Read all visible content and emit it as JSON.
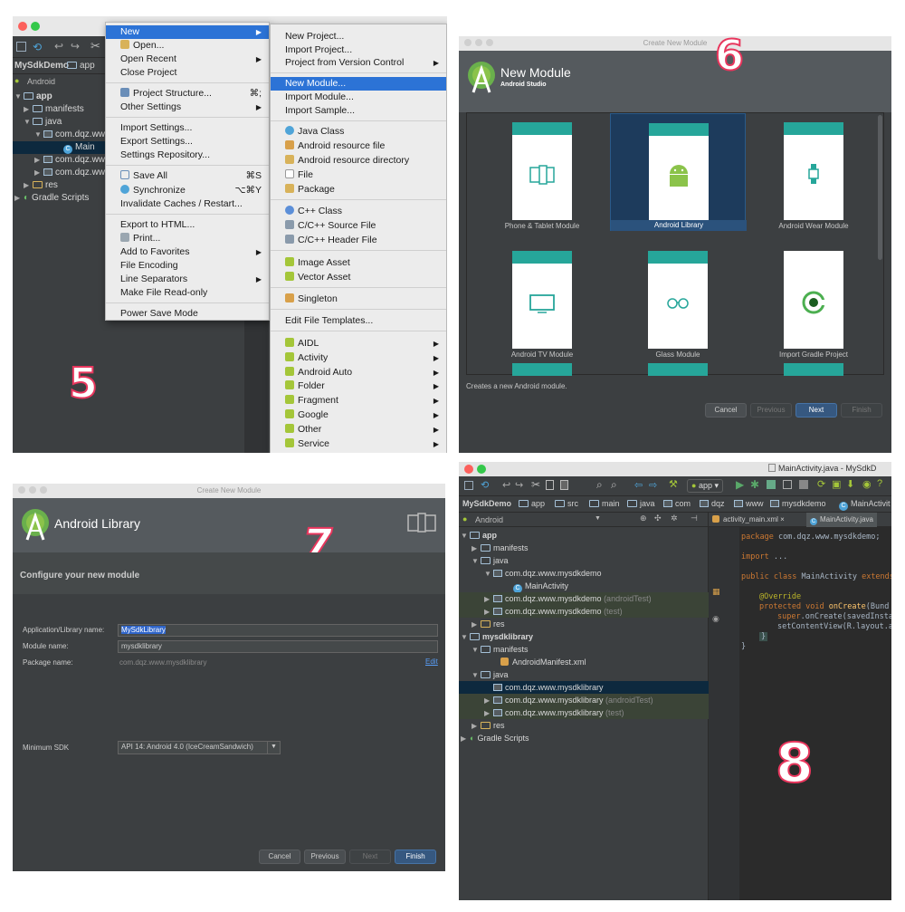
{
  "panel5": {
    "step": "5",
    "project": "MySdkDemo",
    "module": "app",
    "view": "Android",
    "tree": [
      "app",
      "manifests",
      "java",
      "com.dqz.ww",
      "Main",
      "com.dqz.ww",
      "com.dqz.ww",
      "res",
      "Gradle Scripts"
    ],
    "file_menu": {
      "items": [
        {
          "label": "New",
          "sub": "▶",
          "selected": true
        },
        {
          "label": "Open..."
        },
        {
          "label": "Open Recent",
          "sub": "▶"
        },
        {
          "label": "Close Project"
        },
        {
          "label": "Project Structure...",
          "shortcut": "⌘;"
        },
        {
          "label": "Other Settings",
          "sub": "▶"
        },
        {
          "label": "Import Settings..."
        },
        {
          "label": "Export Settings..."
        },
        {
          "label": "Settings Repository..."
        },
        {
          "label": "Save All",
          "shortcut": "⌘S"
        },
        {
          "label": "Synchronize",
          "shortcut": "⌥⌘Y"
        },
        {
          "label": "Invalidate Caches / Restart..."
        },
        {
          "label": "Export to HTML..."
        },
        {
          "label": "Print..."
        },
        {
          "label": "Add to Favorites",
          "sub": "▶"
        },
        {
          "label": "File Encoding"
        },
        {
          "label": "Line Separators",
          "sub": "▶"
        },
        {
          "label": "Make File Read-only"
        },
        {
          "label": "Power Save Mode"
        }
      ]
    },
    "new_menu": {
      "items": [
        {
          "label": "New Project..."
        },
        {
          "label": "Import Project..."
        },
        {
          "label": "Project from Version Control",
          "sub": "▶"
        },
        {
          "label": "New Module...",
          "selected": true
        },
        {
          "label": "Import Module..."
        },
        {
          "label": "Import Sample..."
        },
        {
          "label": "Java Class"
        },
        {
          "label": "Android resource file"
        },
        {
          "label": "Android resource directory"
        },
        {
          "label": "File"
        },
        {
          "label": "Package"
        },
        {
          "label": "C++ Class"
        },
        {
          "label": "C/C++ Source File"
        },
        {
          "label": "C/C++ Header File"
        },
        {
          "label": "Image Asset"
        },
        {
          "label": "Vector Asset"
        },
        {
          "label": "Singleton"
        },
        {
          "label": "Edit File Templates..."
        },
        {
          "label": "AIDL",
          "sub": "▶"
        },
        {
          "label": "Activity",
          "sub": "▶"
        },
        {
          "label": "Android Auto",
          "sub": "▶"
        },
        {
          "label": "Folder",
          "sub": "▶"
        },
        {
          "label": "Fragment",
          "sub": "▶"
        },
        {
          "label": "Google",
          "sub": "▶"
        },
        {
          "label": "Other",
          "sub": "▶"
        },
        {
          "label": "Service",
          "sub": "▶"
        }
      ]
    }
  },
  "panel6": {
    "step": "6",
    "window_title": "Create New Module",
    "header_title": "New Module",
    "header_sub": "Android Studio",
    "cards": [
      {
        "label": "Phone & Tablet Module"
      },
      {
        "label": "Android Library",
        "selected": true
      },
      {
        "label": "Android Wear Module"
      },
      {
        "label": "Android TV Module"
      },
      {
        "label": "Glass Module"
      },
      {
        "label": "Import Gradle Project"
      }
    ],
    "description": "Creates a new Android module.",
    "buttons": {
      "cancel": "Cancel",
      "previous": "Previous",
      "next": "Next",
      "finish": "Finish"
    }
  },
  "panel7": {
    "step": "7",
    "window_title": "Create New Module",
    "header_title": "Android Library",
    "section_title": "Configure your new module",
    "fields": {
      "app_name_label": "Application/Library name:",
      "app_name_value": "MySdkLibrary",
      "module_label": "Module name:",
      "module_value": "mysdklibrary",
      "package_label": "Package name:",
      "package_value": "com.dqz.www.mysdklibrary",
      "edit_link": "Edit",
      "min_sdk_label": "Minimum SDK",
      "min_sdk_value": "API 14: Android 4.0 (IceCreamSandwich)"
    },
    "buttons": {
      "cancel": "Cancel",
      "previous": "Previous",
      "next": "Next",
      "finish": "Finish"
    }
  },
  "panel8": {
    "step": "8",
    "window_title": "MainActivity.java - MySdkD",
    "run_config": "app",
    "breadcrumb": [
      "MySdkDemo",
      "app",
      "src",
      "main",
      "java",
      "com",
      "dqz",
      "www",
      "mysdkdemo",
      "MainActivit"
    ],
    "view": "Android",
    "tabs": [
      "activity_main.xml",
      "MainActivity.java"
    ],
    "tree": {
      "app": "app",
      "manifests": "manifests",
      "java": "java",
      "pkg_main": "com.dqz.www.mysdkdemo",
      "main_activity": "MainActivity",
      "pkg_android_test": "com.dqz.www.mysdkdemo",
      "android_test_suffix": "(androidTest)",
      "pkg_test": "com.dqz.www.mysdkdemo",
      "test_suffix": "(test)",
      "res": "res",
      "lib": "mysdklibrary",
      "lib_manifests": "manifests",
      "lib_manifest_file": "AndroidManifest.xml",
      "lib_java": "java",
      "lib_pkg": "com.dqz.www.mysdklibrary",
      "lib_pkg_android_test": "com.dqz.www.mysdklibrary",
      "lib_pkg_test": "com.dqz.www.mysdklibrary",
      "lib_res": "res",
      "gradle": "Gradle Scripts"
    },
    "code": {
      "l1_kw": "package",
      "l1": " com.dqz.www.mysdkdemo;",
      "l2_kw": "import",
      "l2": " ...",
      "l3_kw": "public class",
      "l3": " MainActivity ",
      "l3_ext": "extends",
      "l4": "@Override",
      "l5_kw": "protected void",
      "l5_fn": " onCreate",
      "l5": "(Bund",
      "l6_kw": "super",
      "l6": ".onCreate(savedInsta",
      "l7": "setContentView(R.layout.a",
      "l8": "}",
      "l9": "}"
    }
  }
}
